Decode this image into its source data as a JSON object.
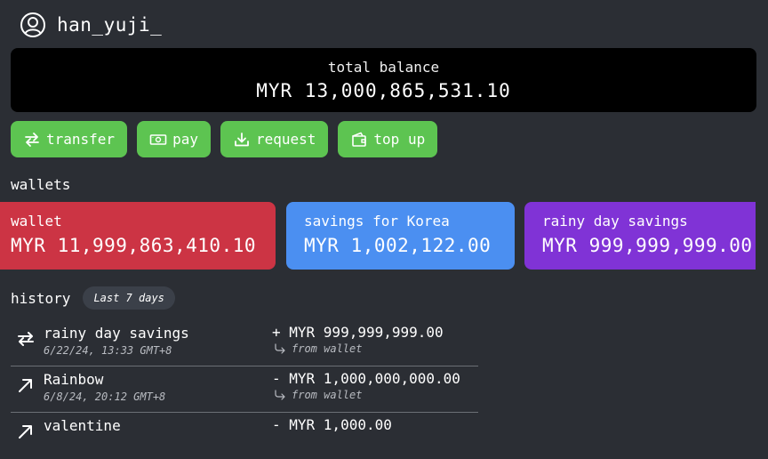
{
  "user": {
    "username": "han_yuji_",
    "icon": "user-circle-icon"
  },
  "balance": {
    "label": "total balance",
    "value": "MYR 13,000,865,531.10"
  },
  "actions": [
    {
      "label": "transfer",
      "icon": "transfer-arrows-icon"
    },
    {
      "label": "pay",
      "icon": "cash-icon"
    },
    {
      "label": "request",
      "icon": "download-icon"
    },
    {
      "label": "top up",
      "icon": "wallet-icon"
    }
  ],
  "wallets": {
    "title": "wallets",
    "items": [
      {
        "name": "wallet",
        "amount": "MYR 11,999,863,410.10",
        "color": "#cc3444"
      },
      {
        "name": "savings for Korea",
        "amount": "MYR 1,002,122.00",
        "color": "#4b8ff1"
      },
      {
        "name": "rainy day savings",
        "amount": "MYR 999,999,999.00",
        "color": "#8033d6"
      }
    ]
  },
  "history": {
    "title": "history",
    "range": "Last 7 days",
    "items": [
      {
        "title": "rainy day savings",
        "time": "6/22/24, 13:33 GMT+8",
        "amount": "+ MYR 999,999,999.00",
        "from": "from wallet",
        "icon": "transfer-arrows-icon"
      },
      {
        "title": "Rainbow",
        "time": "6/8/24, 20:12 GMT+8",
        "amount": "- MYR 1,000,000,000.00",
        "from": "from wallet",
        "icon": "arrow-up-right-icon"
      },
      {
        "title": "valentine",
        "time": "",
        "amount": "- MYR 1,000.00",
        "from": "",
        "icon": "arrow-up-right-icon"
      }
    ]
  },
  "colors": {
    "background": "#2b2e34",
    "action": "#5dc451",
    "card": "#000000"
  }
}
